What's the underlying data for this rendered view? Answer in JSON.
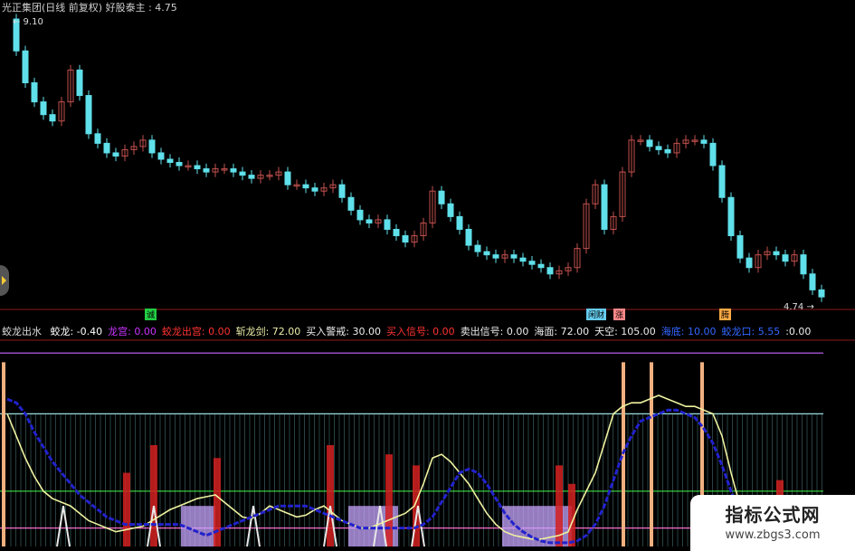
{
  "header": {
    "stock": "光正集团(日线 前复权)",
    "indicator_name": "好股泰主",
    "indicator_value": "4.75"
  },
  "price_high_label": "9.10",
  "price_low_label": "4.74",
  "flags": [
    {
      "text": "诚",
      "color": "#22cc44"
    },
    {
      "text": "闲财",
      "color": "#66ccee"
    },
    {
      "text": "涨",
      "color": "#ff8888"
    },
    {
      "text": "腾",
      "color": "#ffaa44"
    }
  ],
  "indicator": {
    "name": "蛟龙出水",
    "items": [
      {
        "label": "蛟龙:",
        "value": "-0.40",
        "color": "#ffffff"
      },
      {
        "label": "龙宫:",
        "value": "0.00",
        "color": "#cc33ff"
      },
      {
        "label": "蛟龙出宫:",
        "value": "0.00",
        "color": "#ff3333"
      },
      {
        "label": "斩龙剑:",
        "value": "72.00",
        "color": "#eeeeaa"
      },
      {
        "label": "买入警戒:",
        "value": "30.00",
        "color": "#eeeeee"
      },
      {
        "label": "买入信号:",
        "value": "0.00",
        "color": "#ff3333"
      },
      {
        "label": "卖出信号:",
        "value": "0.00",
        "color": "#eeeeee"
      },
      {
        "label": "海面:",
        "value": "72.00",
        "color": "#eeeeee"
      },
      {
        "label": "天空:",
        "value": "105.00",
        "color": "#eeeeee"
      },
      {
        "label": "海底:",
        "value": "10.00",
        "color": "#3366ff"
      },
      {
        "label": "蛟龙口:",
        "value": "5.55",
        "color": "#3366ff"
      },
      {
        "label": "",
        "value": ":0.00",
        "color": "#eeeeee"
      }
    ]
  },
  "watermark": {
    "title": "指标公式网",
    "url": "www.zbgs3.com"
  },
  "chart_data": [
    {
      "type": "line",
      "x": [
        0,
        10,
        20,
        30,
        40,
        50,
        60,
        70,
        80,
        90,
        100,
        110,
        120,
        130,
        140,
        150,
        160,
        170,
        180,
        190,
        200,
        210,
        220,
        230,
        240,
        250,
        260,
        270,
        280,
        290,
        300,
        310,
        320,
        330,
        340,
        350,
        360,
        370,
        380,
        390,
        400,
        410,
        420,
        430,
        440,
        450,
        460,
        470,
        480,
        490,
        500,
        510,
        520,
        530,
        540,
        550,
        560,
        570,
        580,
        590,
        600,
        610,
        620,
        630,
        640,
        650,
        660,
        670,
        680,
        690,
        700,
        710,
        720,
        730,
        740,
        750,
        760,
        770,
        780,
        790,
        800,
        810,
        820,
        830,
        840,
        850,
        860,
        870,
        880,
        890,
        900
      ],
      "y": [
        9.1,
        8.6,
        8.1,
        7.8,
        7.6,
        7.5,
        7.8,
        8.3,
        7.9,
        7.3,
        7.15,
        7.0,
        6.95,
        7.05,
        7.1,
        7.2,
        7.0,
        6.9,
        6.85,
        6.8,
        6.8,
        6.75,
        6.7,
        6.75,
        6.75,
        6.7,
        6.65,
        6.6,
        6.65,
        6.65,
        6.7,
        6.5,
        6.5,
        6.45,
        6.4,
        6.45,
        6.5,
        6.3,
        6.1,
        5.95,
        5.9,
        5.95,
        5.8,
        5.7,
        5.6,
        5.7,
        5.9,
        6.4,
        6.2,
        6.0,
        5.8,
        5.55,
        5.45,
        5.4,
        5.35,
        5.4,
        5.35,
        5.3,
        5.25,
        5.2,
        5.1,
        5.15,
        5.2,
        5.5,
        6.2,
        6.5,
        5.8,
        6.0,
        6.7,
        7.2,
        7.2,
        7.1,
        7.05,
        7.0,
        7.15,
        7.2,
        7.2,
        7.15,
        6.8,
        6.3,
        5.7,
        5.35,
        5.2,
        5.4,
        5.45,
        5.4,
        5.3,
        5.4,
        5.1,
        4.85,
        4.74
      ],
      "ylim": [
        4.6,
        9.2
      ],
      "title": "",
      "xlabel": "",
      "ylabel": ""
    },
    {
      "type": "line",
      "x": [
        0,
        10,
        20,
        30,
        40,
        50,
        60,
        70,
        80,
        90,
        100,
        110,
        120,
        130,
        140,
        150,
        160,
        170,
        180,
        190,
        200,
        210,
        220,
        230,
        240,
        250,
        260,
        270,
        280,
        290,
        300,
        310,
        320,
        330,
        340,
        350,
        360,
        370,
        380,
        390,
        400,
        410,
        420,
        430,
        440,
        450,
        460,
        470,
        480,
        490,
        500,
        510,
        520,
        530,
        540,
        550,
        560,
        570,
        580,
        590,
        600,
        610,
        620,
        630,
        640,
        650,
        660,
        670,
        680,
        690,
        700,
        710,
        720,
        730,
        740,
        750,
        760,
        770,
        780,
        790,
        800,
        810,
        820,
        830,
        840,
        850,
        860,
        870,
        880,
        890,
        900
      ],
      "ylim": [
        0,
        110
      ],
      "levels": [
        {
          "name": "天空",
          "value": 105
        },
        {
          "name": "海面",
          "value": 72
        },
        {
          "name": "买入警戒",
          "value": 30
        },
        {
          "name": "海底",
          "value": 10
        }
      ],
      "series": [
        {
          "name": "斩龙剑",
          "values": [
            72,
            60,
            48,
            38,
            30,
            26,
            24,
            22,
            18,
            14,
            12,
            10,
            8,
            9,
            10,
            11,
            14,
            17,
            20,
            22,
            24,
            26,
            27,
            28,
            24,
            20,
            16,
            15,
            18,
            22,
            20,
            18,
            16,
            17,
            20,
            22,
            18,
            14,
            12,
            10,
            10,
            12,
            14,
            16,
            18,
            22,
            34,
            48,
            50,
            46,
            40,
            34,
            26,
            18,
            12,
            8,
            6,
            5,
            4,
            4,
            5,
            6,
            8,
            20,
            30,
            40,
            56,
            72,
            76,
            78,
            78,
            80,
            82,
            80,
            78,
            76,
            76,
            74,
            72,
            60,
            40,
            22,
            10,
            6,
            4,
            3,
            3,
            3,
            3,
            3,
            3
          ]
        },
        {
          "name": "蛟龙",
          "values": [
            80,
            78,
            72,
            62,
            54,
            46,
            40,
            34,
            28,
            24,
            20,
            16,
            14,
            12,
            12,
            12,
            12,
            12,
            12,
            12,
            10,
            8,
            6,
            8,
            10,
            12,
            14,
            16,
            18,
            20,
            22,
            22,
            22,
            22,
            20,
            18,
            16,
            14,
            12,
            10,
            10,
            10,
            10,
            10,
            10,
            10,
            12,
            16,
            24,
            32,
            40,
            42,
            40,
            34,
            26,
            18,
            12,
            8,
            5,
            3,
            2,
            2,
            2,
            3,
            6,
            12,
            22,
            36,
            50,
            60,
            68,
            70,
            72,
            74,
            74,
            72,
            70,
            64,
            56,
            44,
            30,
            18,
            10,
            6,
            4,
            3,
            3,
            3,
            3,
            3,
            3
          ]
        }
      ]
    }
  ]
}
